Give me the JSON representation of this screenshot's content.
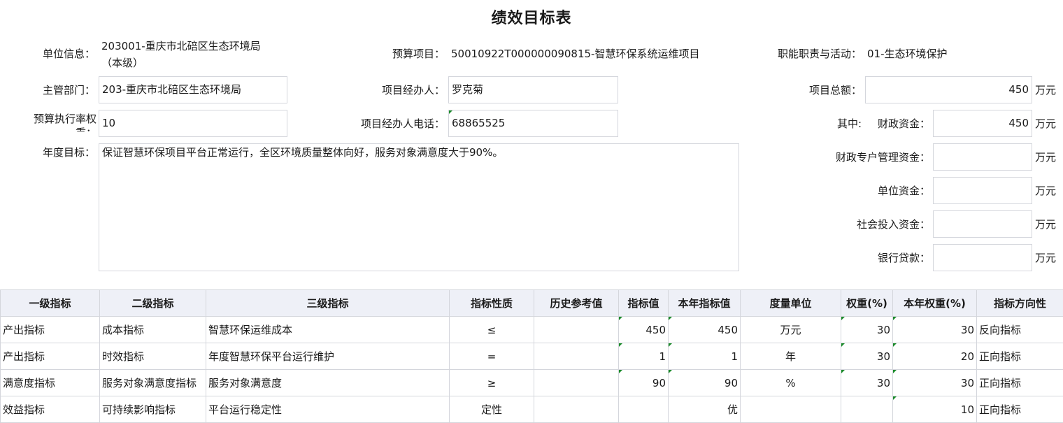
{
  "title": "绩效目标表",
  "unit_info": {
    "label": "单位信息：",
    "value_line1": "203001-重庆市北碚区生态环境局",
    "value_line2": "（本级）"
  },
  "budget_project": {
    "label": "预算项目：",
    "value": "50010922T000000090815-智慧环保系统运维项目"
  },
  "function_activity": {
    "label": "职能职责与活动：",
    "value": "01-生态环境保护"
  },
  "dept": {
    "label": "主管部门：",
    "value": "203-重庆市北碚区生态环境局"
  },
  "manager": {
    "label": "项目经办人：",
    "value": "罗克菊"
  },
  "total": {
    "label": "项目总额：",
    "value": "450",
    "unit": "万元"
  },
  "exec_weight": {
    "label": "预算执行率权重：",
    "value": "10"
  },
  "manager_phone": {
    "label": "项目经办人电话：",
    "value": "68865525"
  },
  "fiscal": {
    "prefix": "其中:",
    "label": "财政资金：",
    "value": "450",
    "unit": "万元"
  },
  "annual_goal": {
    "label": "年度目标：",
    "value": "保证智慧环保项目平台正常运行，全区环境质量整体向好，服务对象满意度大于90%。"
  },
  "special_fund": {
    "label": "财政专户管理资金：",
    "value": "",
    "unit": "万元"
  },
  "unit_fund": {
    "label": "单位资金：",
    "value": "",
    "unit": "万元"
  },
  "social_fund": {
    "label": "社会投入资金：",
    "value": "",
    "unit": "万元"
  },
  "bank_loan": {
    "label": "银行贷款：",
    "value": "",
    "unit": "万元"
  },
  "table": {
    "headers": [
      "一级指标",
      "二级指标",
      "三级指标",
      "指标性质",
      "历史参考值",
      "指标值",
      "本年指标值",
      "度量单位",
      "权重(%)",
      "本年权重(%)",
      "指标方向性"
    ],
    "rows": [
      [
        "产出指标",
        "成本指标",
        "智慧环保运维成本",
        "≤",
        "",
        "450",
        "450",
        "万元",
        "30",
        "30",
        "反向指标"
      ],
      [
        "产出指标",
        "时效指标",
        "年度智慧环保平台运行维护",
        "=",
        "",
        "1",
        "1",
        "年",
        "30",
        "20",
        "正向指标"
      ],
      [
        "满意度指标",
        "服务对象满意度指标",
        "服务对象满意度",
        "≥",
        "",
        "90",
        "90",
        "%",
        "30",
        "30",
        "正向指标"
      ],
      [
        "效益指标",
        "可持续影响指标",
        "平台运行稳定性",
        "定性",
        "",
        "",
        "优",
        "",
        "",
        "10",
        "正向指标"
      ]
    ]
  }
}
